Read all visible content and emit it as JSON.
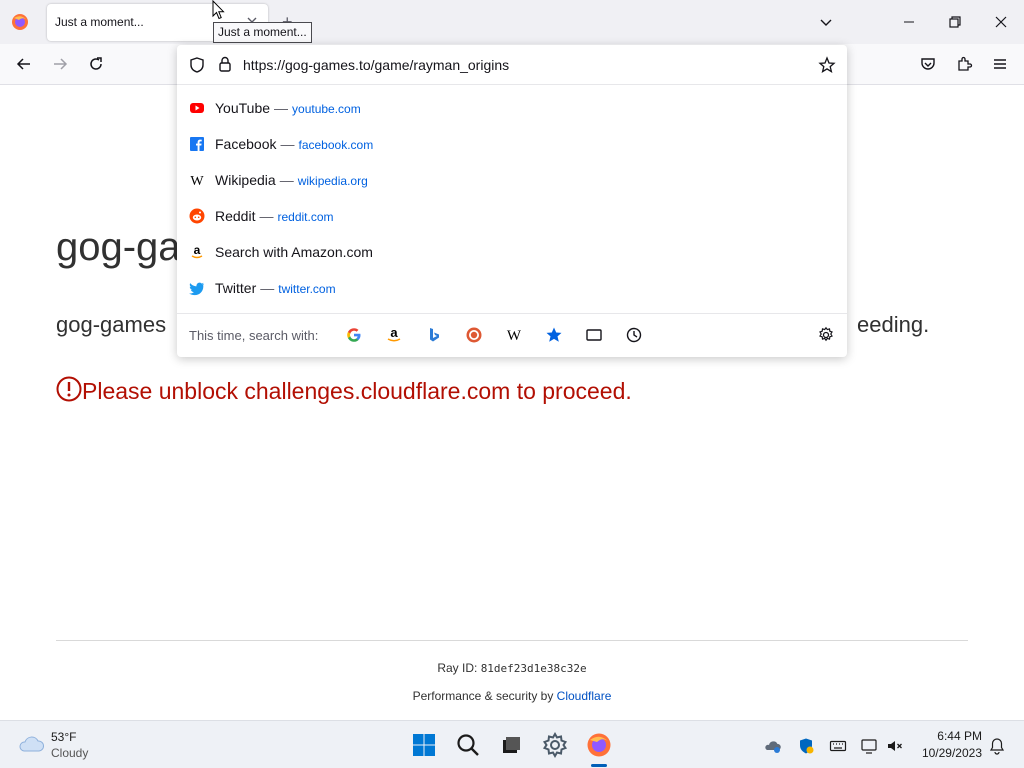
{
  "browser": {
    "tab_title": "Just a moment...",
    "tooltip": "Just a moment...",
    "url": "https://gog-games.to/game/rayman_origins"
  },
  "suggestions": [
    {
      "name": "YouTube",
      "site": "youtube.com",
      "icon": "youtube-icon",
      "color": "#ff0000"
    },
    {
      "name": "Facebook",
      "site": "facebook.com",
      "icon": "facebook-icon",
      "color": "#1877f2"
    },
    {
      "name": "Wikipedia",
      "site": "wikipedia.org",
      "icon": "wikipedia-icon",
      "color": "#000000"
    },
    {
      "name": "Reddit",
      "site": "reddit.com",
      "icon": "reddit-icon",
      "color": "#ff4500"
    },
    {
      "name": "Search with Amazon.com",
      "site": "",
      "icon": "amazon-icon",
      "color": "#000000"
    },
    {
      "name": "Twitter",
      "site": "twitter.com",
      "icon": "twitter-icon",
      "color": "#1d9bf0"
    }
  ],
  "separator": "—",
  "search_with_label": "This time, search with:",
  "page": {
    "heading": "gog-ga",
    "subtitle": "gog-games",
    "subtitle_tail": "eeding.",
    "error": "Please unblock challenges.cloudflare.com to proceed.",
    "ray_label": "Ray ID:",
    "ray_id": "81def23d1e38c32e",
    "perf_label": "Performance & security by",
    "perf_link": "Cloudflare"
  },
  "taskbar": {
    "temperature": "53°F",
    "condition": "Cloudy",
    "time": "6:44 PM",
    "date": "10/29/2023"
  },
  "colors": {
    "error_red": "#b20f03",
    "link_blue": "#0051c3",
    "suggestion_site_blue": "#0061e0"
  }
}
